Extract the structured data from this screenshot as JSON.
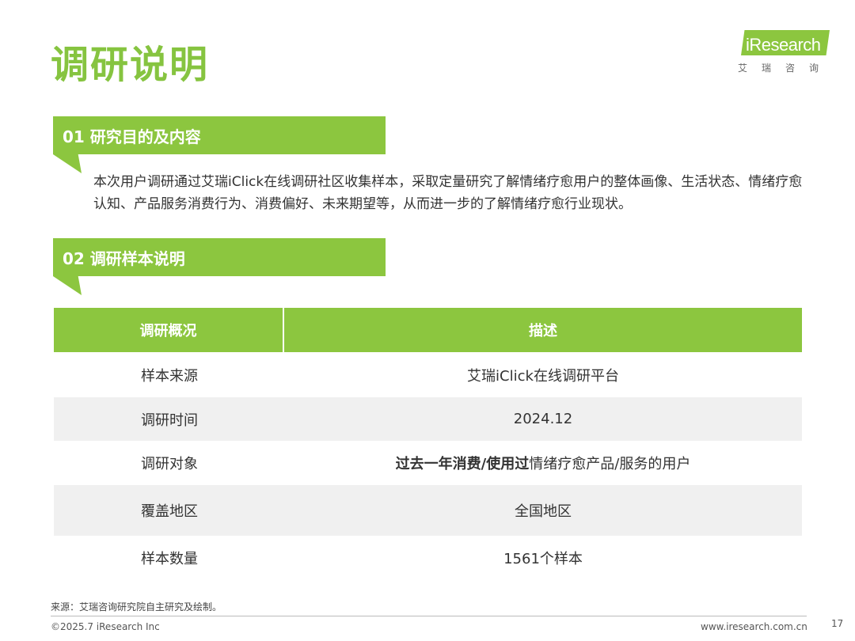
{
  "page": {
    "title": "调研说明",
    "number": "17"
  },
  "logo": {
    "name": "iResearch",
    "subtitle": "艾瑞咨询",
    "color": "#8cc63f"
  },
  "section1": {
    "heading": "01 研究目的及内容",
    "body": "本次用户调研通过艾瑞iClick在线调研社区收集样本，采取定量研究了解情绪疗愈用户的整体画像、生活状态、情绪疗愈认知、产品服务消费行为、消费偏好、未来期望等，从而进一步的了解情绪疗愈行业现状。"
  },
  "section2": {
    "heading": "02 调研样本说明"
  },
  "table": {
    "headers": [
      "调研概况",
      "描述"
    ],
    "rows": [
      {
        "label": "样本来源",
        "value": "艾瑞iClick在线调研平台"
      },
      {
        "label": "调研时间",
        "value": "2024.12"
      },
      {
        "label": "调研对象",
        "value_bold": "过去一年消费/使用过",
        "value": "情绪疗愈产品/服务的用户"
      },
      {
        "label": "覆盖地区",
        "value": "全国地区"
      },
      {
        "label": "样本数量",
        "value": "1561个样本"
      }
    ]
  },
  "footer": {
    "source": "来源：艾瑞咨询研究院自主研究及绘制。",
    "copyright": "©2025.7 iResearch Inc",
    "website": "www.iresearch.com.cn"
  },
  "colors": {
    "accent": "#8cc63f",
    "title": "#86c440",
    "row_alt": "#f0f0f0"
  }
}
